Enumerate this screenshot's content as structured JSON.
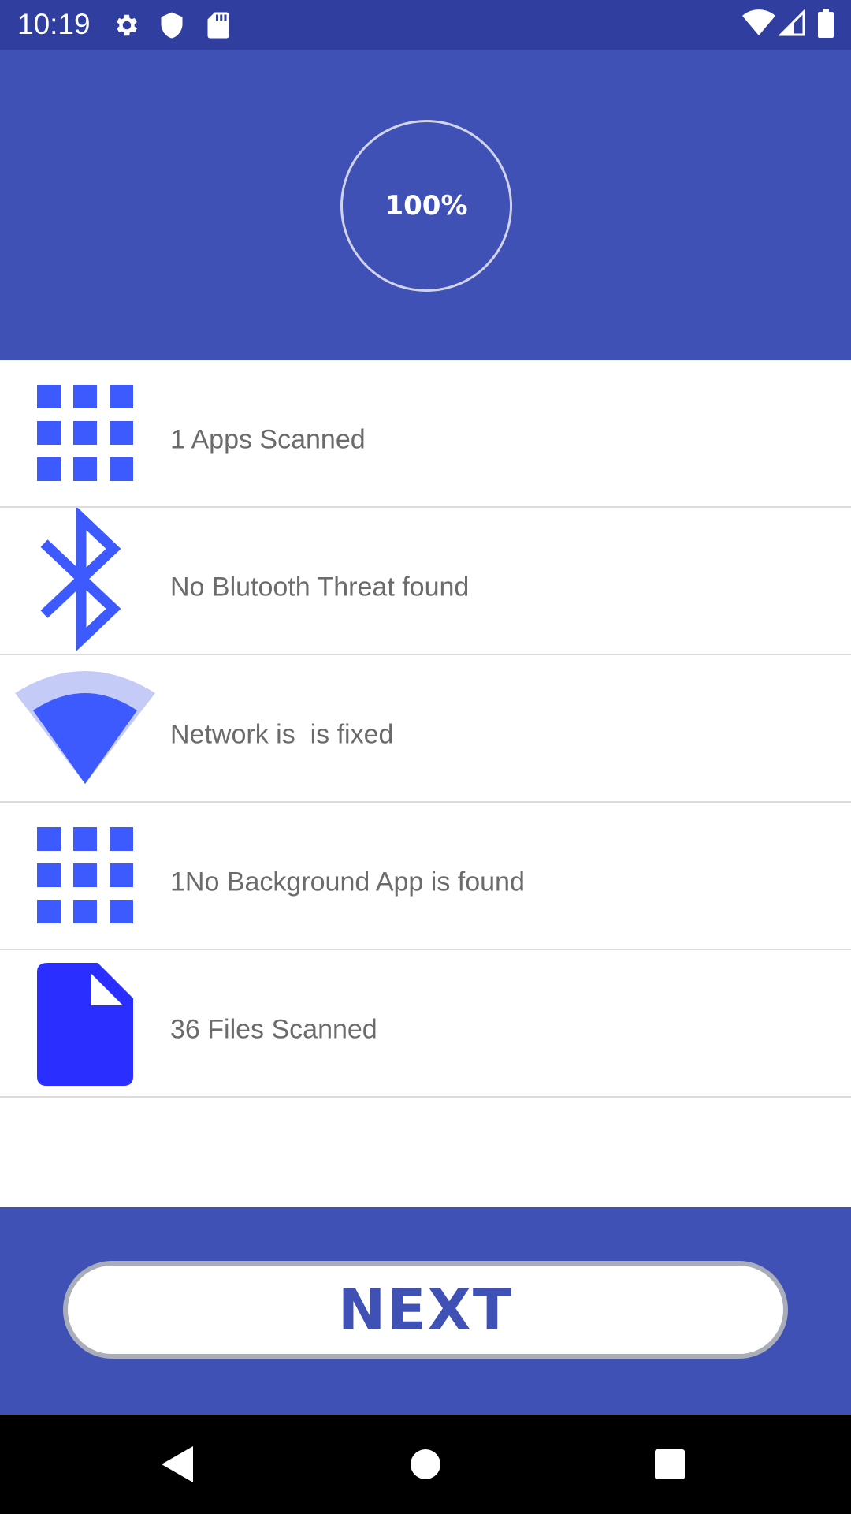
{
  "status_bar": {
    "time": "10:19",
    "left_icons": [
      "gear-icon",
      "shield-icon",
      "sd-card-icon"
    ],
    "right_icons": [
      "wifi-icon",
      "signal-icon",
      "battery-icon"
    ]
  },
  "header": {
    "progress_text": "100%",
    "progress_value": 1.0
  },
  "scan_results": [
    {
      "icon": "apps-grid-icon",
      "label": "1 Apps Scanned"
    },
    {
      "icon": "bluetooth-icon",
      "label": "No Blutooth Threat found"
    },
    {
      "icon": "wifi-network-icon",
      "label": "Network is  is fixed"
    },
    {
      "icon": "apps-grid-icon",
      "label": "1No Background App is found"
    },
    {
      "icon": "file-icon",
      "label": "36 Files Scanned"
    }
  ],
  "footer": {
    "next_label": "NEXT"
  },
  "nav_bar": {
    "buttons": [
      "back-icon",
      "home-icon",
      "recents-icon"
    ]
  },
  "colors": {
    "status_bar": "#303f9f",
    "primary": "#3f51b5",
    "icon_blue": "#3d5afe",
    "file_blue": "#2a2eff",
    "label_gray": "#6b6b6b"
  }
}
